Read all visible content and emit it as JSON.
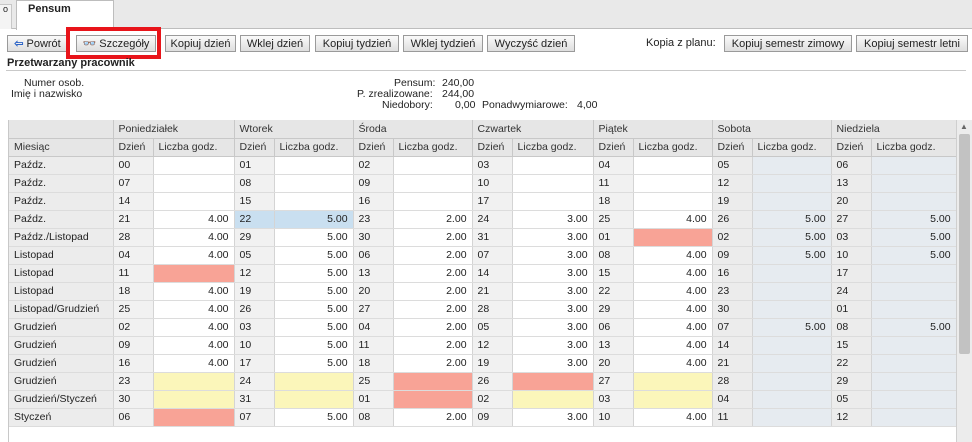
{
  "tabs": {
    "prev_label": "o",
    "active_label": "Pensum"
  },
  "toolbar": {
    "back": "Powrót",
    "details": "Szczegóły",
    "copy_day": "Kopiuj dzień",
    "paste_day": "Wklej dzień",
    "copy_week": "Kopiuj tydzień",
    "paste_week": "Wklej tydzień",
    "clear_day": "Wyczyść dzień",
    "copy_from_plan_label": "Kopia z planu:",
    "copy_winter": "Kopiuj semestr zimowy",
    "copy_summer": "Kopiuj semestr letni"
  },
  "section_title": "Przetwarzany pracownik",
  "employee": {
    "number_label": "Numer osob.",
    "name_label": "Imię i nazwisko",
    "pensum_label": "Pensum:",
    "pensum_value": "240,00",
    "realized_label": "P. zrealizowane:",
    "realized_value": "244,00",
    "shortfall_label": "Niedobory:",
    "shortfall_value": "0,00",
    "overtime_label": "Ponadwymiarowe:",
    "overtime_value": "4,00"
  },
  "grid": {
    "day_names": [
      "Poniedziałek",
      "Wtorek",
      "Środa",
      "Czwartek",
      "Piątek",
      "Sobota",
      "Niedziela"
    ],
    "month_header": "Miesiąc",
    "day_header": "Dzień",
    "hours_header": "Liczba godz.",
    "rows": [
      {
        "month": "Paźdz.",
        "cells": [
          [
            "00",
            ""
          ],
          [
            "01",
            ""
          ],
          [
            "02",
            ""
          ],
          [
            "03",
            ""
          ],
          [
            "04",
            ""
          ],
          [
            "05",
            ""
          ],
          [
            "06",
            ""
          ]
        ]
      },
      {
        "month": "Paźdz.",
        "cells": [
          [
            "07",
            ""
          ],
          [
            "08",
            ""
          ],
          [
            "09",
            ""
          ],
          [
            "10",
            ""
          ],
          [
            "11",
            ""
          ],
          [
            "12",
            ""
          ],
          [
            "13",
            ""
          ]
        ]
      },
      {
        "month": "Paźdz.",
        "cells": [
          [
            "14",
            ""
          ],
          [
            "15",
            ""
          ],
          [
            "16",
            ""
          ],
          [
            "17",
            ""
          ],
          [
            "18",
            ""
          ],
          [
            "19",
            ""
          ],
          [
            "20",
            ""
          ]
        ]
      },
      {
        "month": "Paźdz.",
        "cells": [
          [
            "21",
            "4.00"
          ],
          [
            "22",
            "5.00"
          ],
          [
            "23",
            "2.00"
          ],
          [
            "24",
            "3.00"
          ],
          [
            "25",
            "4.00"
          ],
          [
            "26",
            "5.00"
          ],
          [
            "27",
            "5.00"
          ]
        ]
      },
      {
        "month": "Paźdz./Listopad",
        "cells": [
          [
            "28",
            "4.00"
          ],
          [
            "29",
            "5.00"
          ],
          [
            "30",
            "2.00"
          ],
          [
            "31",
            "3.00"
          ],
          [
            "01",
            ""
          ],
          [
            "02",
            "5.00"
          ],
          [
            "03",
            "5.00"
          ]
        ]
      },
      {
        "month": "Listopad",
        "cells": [
          [
            "04",
            "4.00"
          ],
          [
            "05",
            "5.00"
          ],
          [
            "06",
            "2.00"
          ],
          [
            "07",
            "3.00"
          ],
          [
            "08",
            "4.00"
          ],
          [
            "09",
            "5.00"
          ],
          [
            "10",
            "5.00"
          ]
        ]
      },
      {
        "month": "Listopad",
        "cells": [
          [
            "11",
            ""
          ],
          [
            "12",
            "5.00"
          ],
          [
            "13",
            "2.00"
          ],
          [
            "14",
            "3.00"
          ],
          [
            "15",
            "4.00"
          ],
          [
            "16",
            ""
          ],
          [
            "17",
            ""
          ]
        ]
      },
      {
        "month": "Listopad",
        "cells": [
          [
            "18",
            "4.00"
          ],
          [
            "19",
            "5.00"
          ],
          [
            "20",
            "2.00"
          ],
          [
            "21",
            "3.00"
          ],
          [
            "22",
            "4.00"
          ],
          [
            "23",
            ""
          ],
          [
            "24",
            ""
          ]
        ]
      },
      {
        "month": "Listopad/Grudzień",
        "cells": [
          [
            "25",
            "4.00"
          ],
          [
            "26",
            "5.00"
          ],
          [
            "27",
            "2.00"
          ],
          [
            "28",
            "3.00"
          ],
          [
            "29",
            "4.00"
          ],
          [
            "30",
            ""
          ],
          [
            "01",
            ""
          ]
        ]
      },
      {
        "month": "Grudzień",
        "cells": [
          [
            "02",
            "4.00"
          ],
          [
            "03",
            "5.00"
          ],
          [
            "04",
            "2.00"
          ],
          [
            "05",
            "3.00"
          ],
          [
            "06",
            "4.00"
          ],
          [
            "07",
            "5.00"
          ],
          [
            "08",
            "5.00"
          ]
        ]
      },
      {
        "month": "Grudzień",
        "cells": [
          [
            "09",
            "4.00"
          ],
          [
            "10",
            "5.00"
          ],
          [
            "11",
            "2.00"
          ],
          [
            "12",
            "3.00"
          ],
          [
            "13",
            "4.00"
          ],
          [
            "14",
            ""
          ],
          [
            "15",
            ""
          ]
        ]
      },
      {
        "month": "Grudzień",
        "cells": [
          [
            "16",
            "4.00"
          ],
          [
            "17",
            "5.00"
          ],
          [
            "18",
            "2.00"
          ],
          [
            "19",
            "3.00"
          ],
          [
            "20",
            "4.00"
          ],
          [
            "21",
            ""
          ],
          [
            "22",
            ""
          ]
        ]
      },
      {
        "month": "Grudzień",
        "cells": [
          [
            "23",
            ""
          ],
          [
            "24",
            ""
          ],
          [
            "25",
            ""
          ],
          [
            "26",
            ""
          ],
          [
            "27",
            ""
          ],
          [
            "28",
            ""
          ],
          [
            "29",
            ""
          ]
        ]
      },
      {
        "month": "Grudzień/Styczeń",
        "cells": [
          [
            "30",
            ""
          ],
          [
            "31",
            ""
          ],
          [
            "01",
            ""
          ],
          [
            "02",
            ""
          ],
          [
            "03",
            ""
          ],
          [
            "04",
            ""
          ],
          [
            "05",
            ""
          ]
        ]
      },
      {
        "month": "Styczeń",
        "cells": [
          [
            "06",
            ""
          ],
          [
            "07",
            "5.00"
          ],
          [
            "08",
            "2.00"
          ],
          [
            "09",
            "3.00"
          ],
          [
            "10",
            "4.00"
          ],
          [
            "11",
            ""
          ],
          [
            "12",
            ""
          ]
        ]
      }
    ],
    "highlights": {
      "red": [
        "4-4",
        "6-0",
        "12-2",
        "12-3",
        "13-2",
        "14-0"
      ],
      "yellow": [
        "12-0",
        "12-1",
        "12-4",
        "13-0",
        "13-1",
        "13-3",
        "13-4"
      ],
      "blue": [
        "3-1"
      ]
    }
  }
}
